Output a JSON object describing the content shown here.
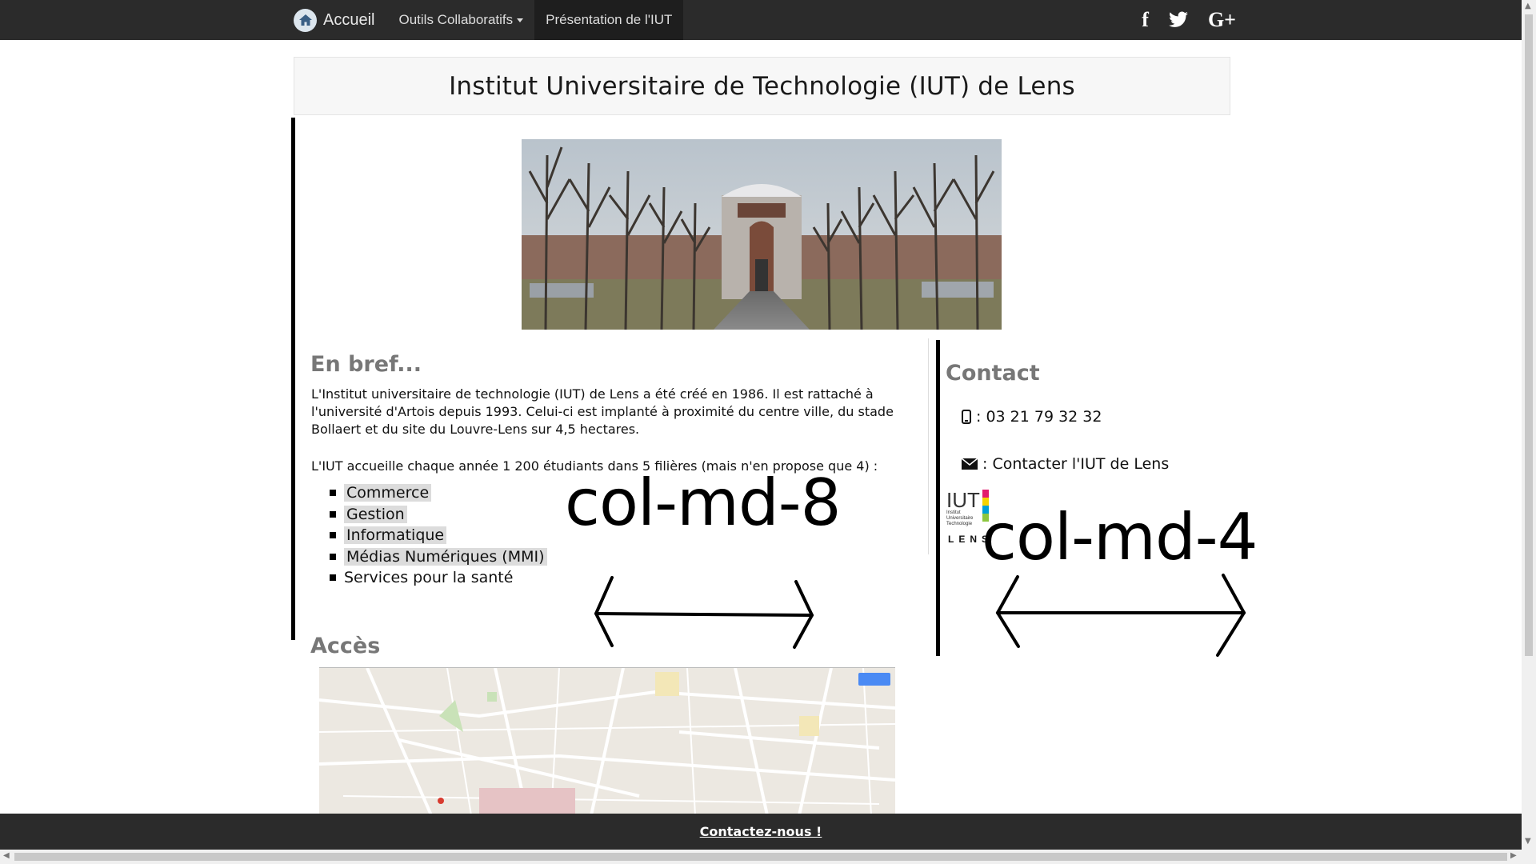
{
  "navbar": {
    "brand": "Accueil",
    "items": [
      {
        "label": "Outils Collaboratifs"
      },
      {
        "label": "Présentation de l'IUT"
      }
    ]
  },
  "social": {
    "facebook": "f",
    "googleplus": "G+"
  },
  "header": {
    "title": "Institut Universitaire de Technologie (IUT) de Lens"
  },
  "bref": {
    "heading": "En bref...",
    "para1": "L'Institut universitaire de technologie (IUT) de Lens a été créé en 1986. Il est rattaché à l'université d'Artois depuis 1993. Celui-ci est implanté à proximité du centre ville, du stade Bollaert et du site du Louvre-Lens sur 4,5 hectares.",
    "para2": "L'IUT accueille chaque année 1 200 étudiants dans 5 filières (mais n'en propose que 4) :",
    "filieres": [
      "Commerce",
      "Gestion",
      "Informatique",
      "Médias Numériques (MMI)",
      "Services pour la santé"
    ]
  },
  "acces": {
    "heading": "Accès"
  },
  "contact": {
    "heading": "Contact",
    "phone": ": 03 21 79 32 32",
    "email": ": Contacter l'IUT de Lens"
  },
  "logo": {
    "line1": "IUT",
    "line2": "Institut",
    "line3": "Universitaire",
    "line4": "Technologie",
    "line5": "LENS"
  },
  "annotations": {
    "left": "col-md-8",
    "right": "col-md-4"
  },
  "footer": {
    "link": "Contactez-nous !"
  },
  "colors": {
    "navbar": "#2b2b2b",
    "heading_gray": "#777777",
    "highlight": "#dcdcdc"
  }
}
